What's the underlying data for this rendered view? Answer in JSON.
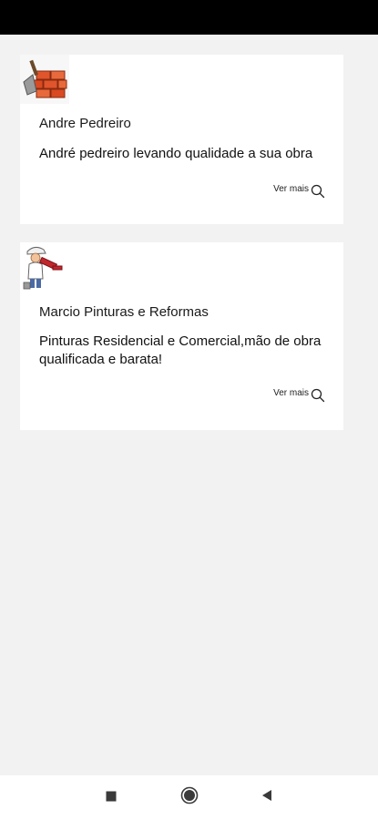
{
  "cards": [
    {
      "title": "Andre Pedreiro",
      "description": "André pedreiro levando qualidade a sua obra",
      "see_more": "Ver mais",
      "thumb_icon": "bricklayer-thumbnail-icon"
    },
    {
      "title": "Marcio Pinturas e Reformas",
      "description": "Pinturas Residencial e Comercial,mão de obra qualificada e barata!",
      "see_more": "Ver mais",
      "thumb_icon": "painter-thumbnail-icon"
    }
  ],
  "nav": {
    "recents_icon": "square-icon",
    "home_icon": "circle-icon",
    "back_icon": "triangle-back-icon"
  },
  "colors": {
    "status_bar": "#000000",
    "background": "#f2f2f2",
    "card": "#ffffff",
    "brick": "#e0552b",
    "text": "#111111"
  }
}
